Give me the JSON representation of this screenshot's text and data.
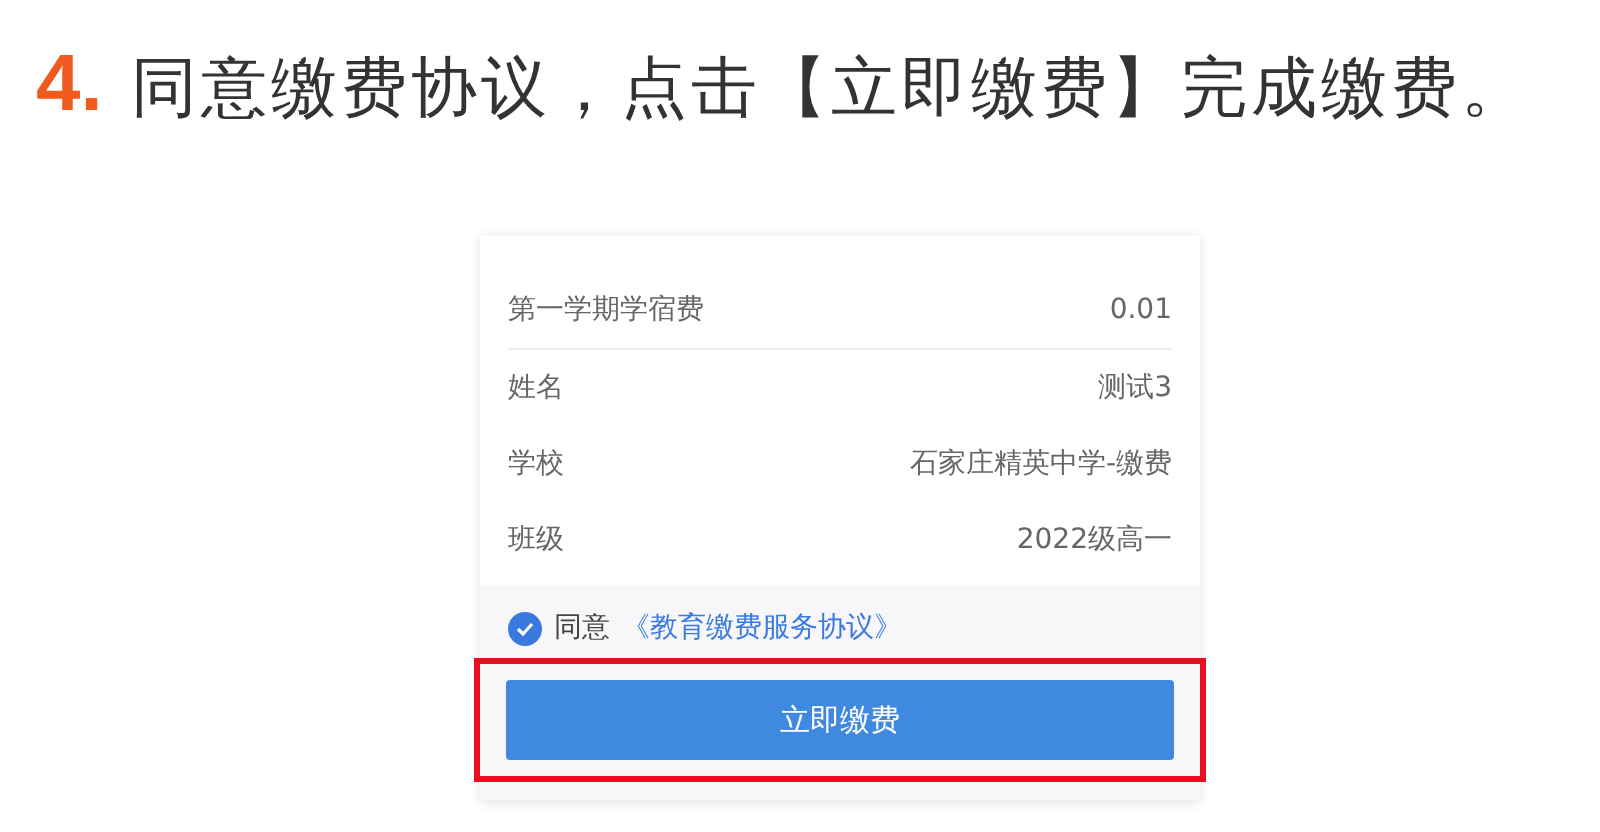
{
  "step": {
    "number": "4.",
    "text": "同意缴费协议，点击【立即缴费】完成缴费。"
  },
  "fee_rows": [
    {
      "label": "第一学期学宿费",
      "value": "0.01"
    },
    {
      "label": "姓名",
      "value": "测试3"
    },
    {
      "label": "学校",
      "value": "石家庄精英中学-缴费"
    },
    {
      "label": "班级",
      "value": "2022级高一"
    }
  ],
  "agreement": {
    "checked": true,
    "prefix": "同意",
    "link": "《教育缴费服务协议》"
  },
  "pay_button": {
    "label": "立即缴费",
    "highlighted": true
  }
}
